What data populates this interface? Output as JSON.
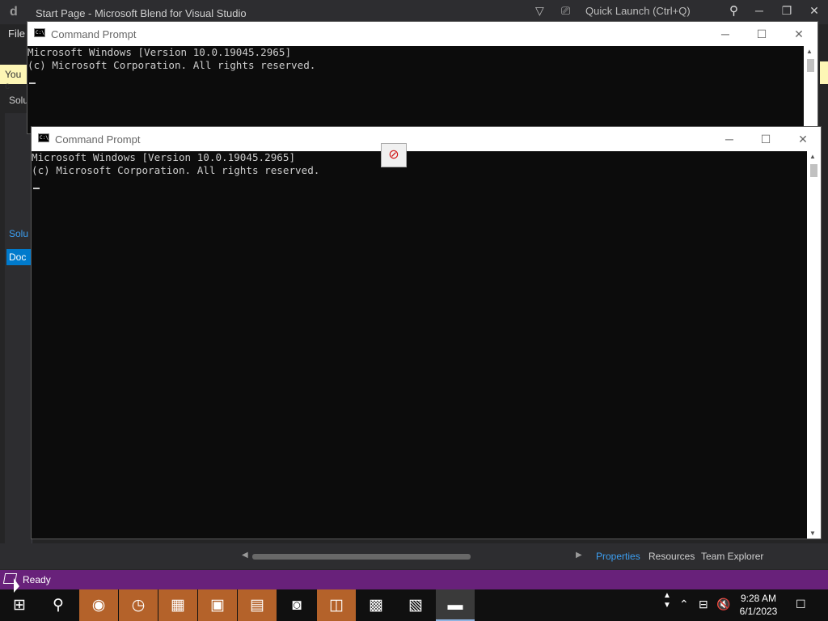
{
  "blend": {
    "title": "Start Page - Microsoft Blend for Visual Studio",
    "quick_launch": "Quick Launch (Ctrl+Q)",
    "menu_file": "File",
    "notice_text": "You c",
    "solution_label": "Solu",
    "solution_tab": "Solu",
    "doc_tab": "Doc",
    "panel_tabs": [
      "Properties",
      "Resources",
      "Team Explorer"
    ],
    "status": "Ready"
  },
  "cmd_back": {
    "title": "Command Prompt",
    "lines": [
      "Microsoft Windows [Version 10.0.19045.2965]",
      "(c) Microsoft Corporation. All rights reserved."
    ]
  },
  "cmd_front": {
    "title": "Command Prompt",
    "lines": [
      "Microsoft Windows [Version 10.0.19045.2965]",
      "(c) Microsoft Corporation. All rights reserved."
    ]
  },
  "taskbar": {
    "time": "9:28 AM",
    "date": "6/1/2023"
  },
  "icons": {
    "window_min": "─",
    "window_max": "☐",
    "window_close": "✕",
    "no_entry": "⃠"
  }
}
